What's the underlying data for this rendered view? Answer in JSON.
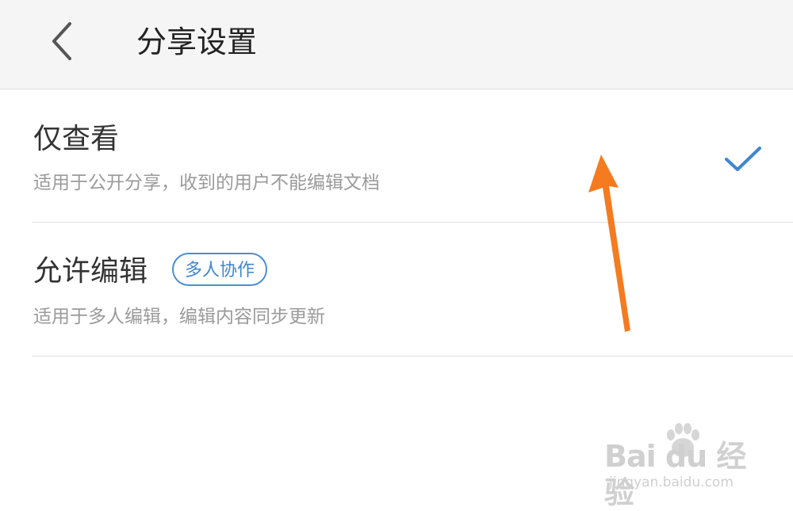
{
  "header": {
    "title": "分享设置",
    "back_icon": "chevron-left-icon"
  },
  "options": [
    {
      "title": "仅查看",
      "description": "适用于公开分享，收到的用户不能编辑文档",
      "selected": true,
      "check_icon": "checkmark-icon"
    },
    {
      "title": "允许编辑",
      "badge": "多人协作",
      "description": "适用于多人编辑，编辑内容同步更新",
      "selected": false
    }
  ],
  "annotation": {
    "arrow_color": "#f47b20"
  },
  "watermark": {
    "main": "Bai du 经验",
    "sub": "jingyan.baidu.com"
  },
  "colors": {
    "accent": "#3f86cf",
    "header_bg": "#f5f5f5",
    "secondary_text": "#9a9a9a"
  }
}
